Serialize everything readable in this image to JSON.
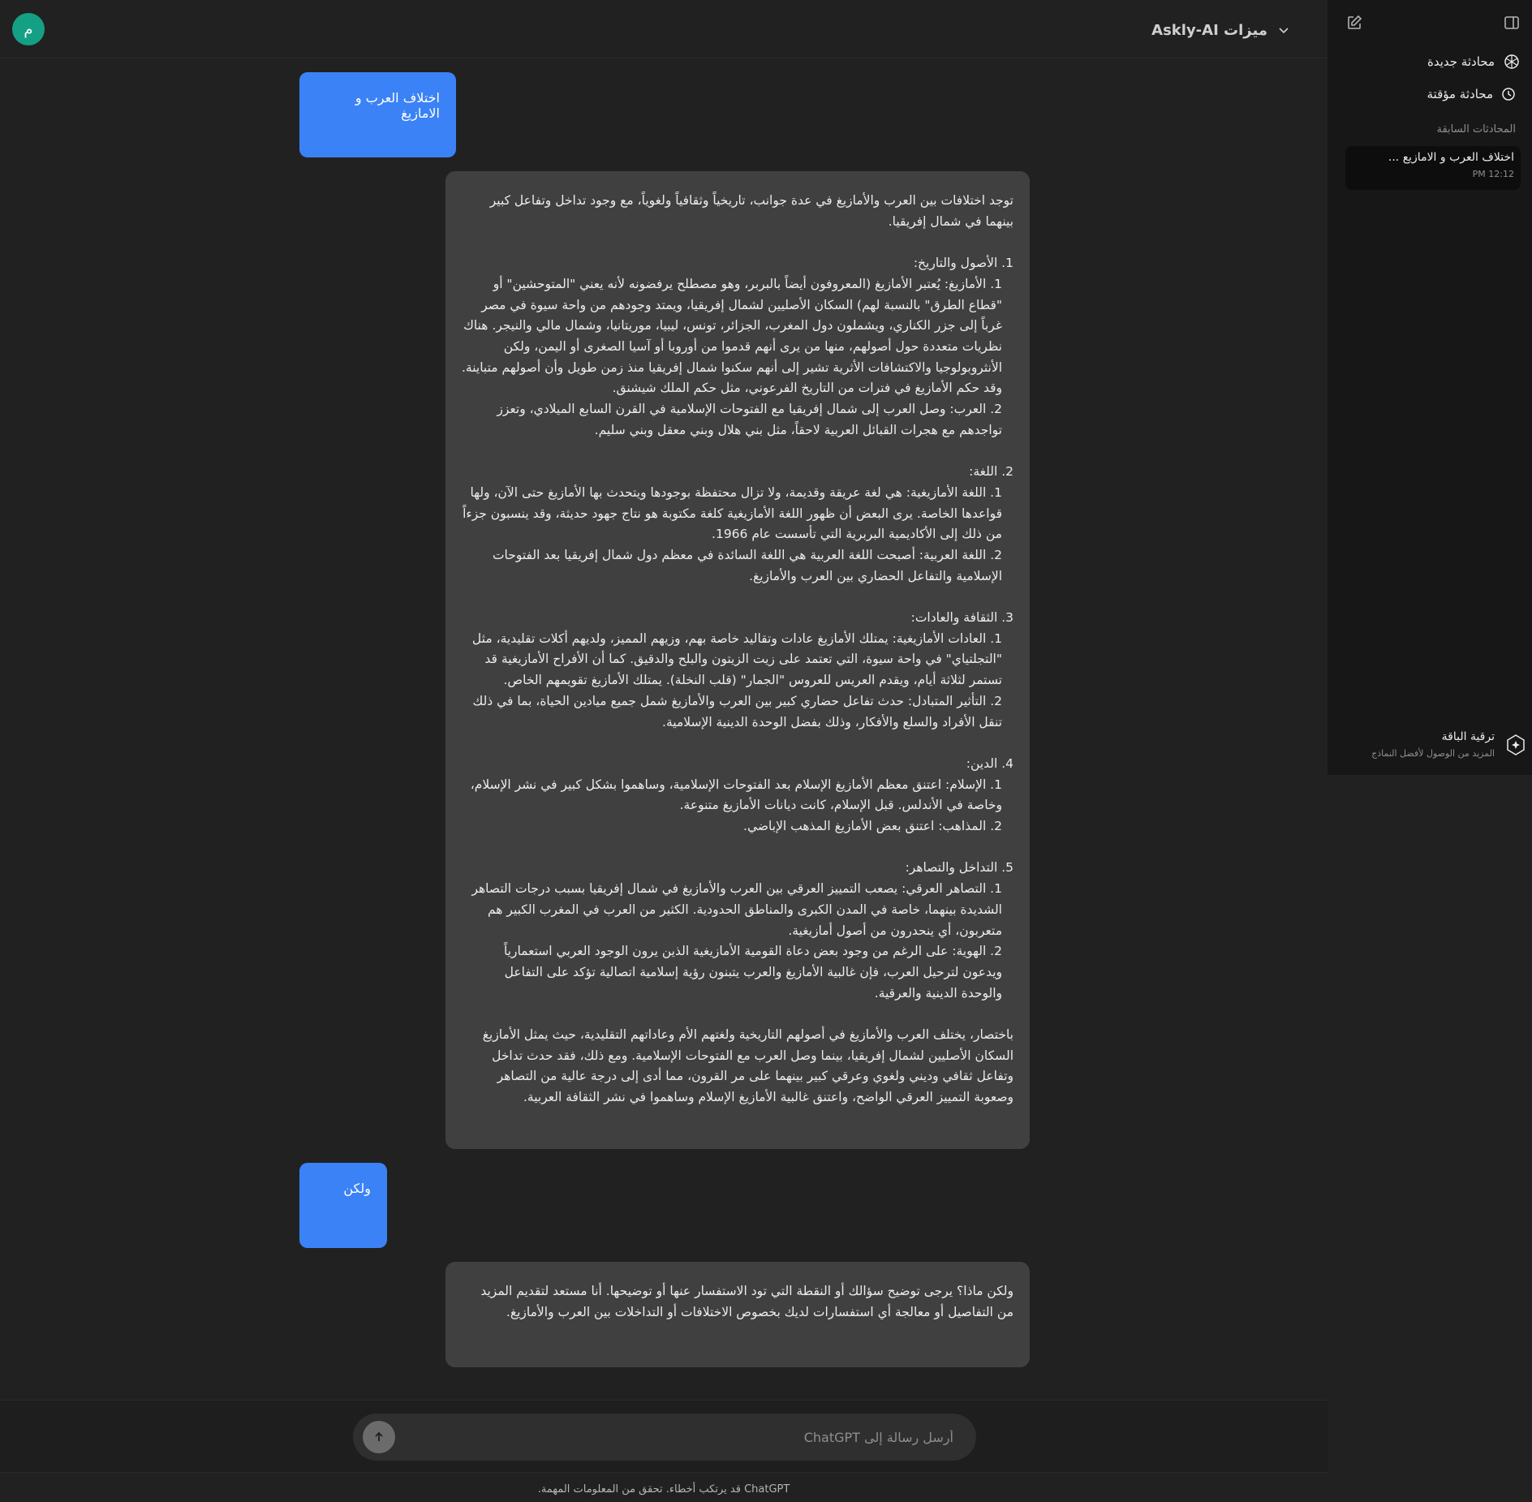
{
  "header": {
    "avatar_letter": "م",
    "model_label": "Askly-AI ميزات"
  },
  "conversation": {
    "user_1": "اختلاف العرب و الامازيغ",
    "assistant_1": {
      "intro": "توجد اختلافات بين العرب والأمازيغ في عدة جوانب، تاريخياً وثقافياً ولغوياً، مع وجود تداخل وتفاعل كبير بينهما في شمال إفريقيا.",
      "s1_title": "1.  الأصول والتاريخ:",
      "s1_p1": "1.  الأمازيغ: يُعتبر الأمازيغ (المعروفون أيضاً بالبربر، وهو مصطلح يرفضونه لأنه يعني \"المتوحشين\" أو \"قطاع الطرق\" بالنسبة لهم) السكان الأصليين لشمال إفريقيا، ويمتد وجودهم من واحة سيوة في مصر غرباً إلى جزر الكناري، ويشملون دول المغرب، الجزائر، تونس، ليبيا، موريتانيا، وشمال مالي والنيجر. هناك نظريات متعددة حول أصولهم، منها من يرى أنهم قدموا من أوروبا أو آسيا الصغرى أو اليمن، ولكن الأنثروبولوجيا والاكتشافات الأثرية تشير إلى أنهم سكنوا شمال إفريقيا منذ زمن طويل وأن أصولهم متباينة. وقد حكم الأمازيغ في فترات من التاريخ الفرعوني، مثل حكم الملك شيشنق.",
      "s1_p2": "2.  العرب: وصل العرب إلى شمال إفريقيا مع الفتوحات الإسلامية في القرن السابع الميلادي، وتعزز تواجدهم مع هجرات القبائل العربية لاحقاً، مثل بني هلال وبني معقل وبني سليم.",
      "s2_title": "2.  اللغة:",
      "s2_p1": "1.  اللغة الأمازيغية: هي لغة عريقة وقديمة، ولا تزال محتفظة بوجودها ويتحدث بها الأمازيغ حتى الآن، ولها قواعدها الخاصة. يرى البعض أن ظهور اللغة الأمازيغية كلغة مكتوبة هو نتاج جهود حديثة، وقد ينسبون جزءاً من ذلك إلى الأكاديمية البربرية التي تأسست عام 1966.",
      "s2_p2": "2.  اللغة العربية: أصبحت اللغة العربية هي اللغة السائدة في معظم دول شمال إفريقيا بعد الفتوحات الإسلامية والتفاعل الحضاري بين العرب والأمازيغ.",
      "s3_title": "3.  الثقافة والعادات:",
      "s3_p1": "1.  العادات الأمازيغية: يمتلك الأمازيغ عادات وتقاليد خاصة بهم، وزيهم المميز، ولديهم أكلات تقليدية، مثل \"التجلتياي\" في واحة سيوة، التي تعتمد على زيت الزيتون والبلح والدقيق. كما أن الأفراح الأمازيغية قد تستمر لثلاثة أيام، ويقدم العريس للعروس \"الجمار\" (قلب النخلة). يمتلك الأمازيغ تقويمهم الخاص.",
      "s3_p2": "2.  التأثير المتبادل: حدث تفاعل حضاري كبير بين العرب والأمازيغ شمل جميع ميادين الحياة، بما في ذلك تنقل الأفراد والسلع والأفكار، وذلك بفضل الوحدة الدينية الإسلامية.",
      "s4_title": "4.  الدين:",
      "s4_p1": "1.  الإسلام: اعتنق معظم الأمازيغ الإسلام بعد الفتوحات الإسلامية، وساهموا بشكل كبير في نشر الإسلام، وخاصة في الأندلس. قبل الإسلام، كانت ديانات الأمازيغ متنوعة.",
      "s4_p2": "2.  المذاهب: اعتنق بعض الأمازيغ المذهب الإباضي.",
      "s5_title": "5.  التداخل والتصاهر:",
      "s5_p1": "1.  التصاهر العرقي: يصعب التمييز العرقي بين العرب والأمازيغ في شمال إفريقيا بسبب درجات التصاهر الشديدة بينهما، خاصة في المدن الكبرى والمناطق الحدودية. الكثير من العرب في المغرب الكبير هم متعربون، أي ينحدرون من أصول أمازيغية.",
      "s5_p2": "2.  الهوية: على الرغم من وجود بعض دعاة القومية الأمازيغية الذين يرون الوجود العربي استعمارياً ويدعون لترحيل العرب، فإن غالبية الأمازيغ والعرب يتبنون رؤية إسلامية اتصالية تؤكد على التفاعل والوحدة الدينية والعرقية.",
      "summary": "باختصار، يختلف العرب والأمازيغ في أصولهم التاريخية ولغتهم الأم وعاداتهم التقليدية، حيث يمثل الأمازيغ السكان الأصليين لشمال إفريقيا، بينما وصل العرب مع الفتوحات الإسلامية. ومع ذلك، فقد حدث تداخل وتفاعل ثقافي وديني ولغوي وعرقي كبير بينهما على مر القرون، مما أدى إلى درجة عالية من التصاهر وصعوبة التمييز العرقي الواضح، واعتنق غالبية الأمازيغ الإسلام وساهموا في نشر الثقافة العربية."
    },
    "user_2": "ولكن",
    "assistant_2": "ولكن ماذا؟ يرجى توضيح سؤالك أو النقطة التي تود الاستفسار عنها أو توضيحها. أنا مستعد لتقديم المزيد من التفاصيل أو معالجة أي استفسارات لديك بخصوص الاختلافات أو التداخلات بين العرب والأمازيغ."
  },
  "composer": {
    "placeholder": "أرسل رسالة إلى ChatGPT"
  },
  "disclaimer": "ChatGPT قد يرتكب أخطاء. تحقق من المعلومات المهمة.",
  "sidebar": {
    "new_chat": "محادثة جديدة",
    "temp_chat": "محادثة مؤقتة",
    "previous_label": "المحادثات السابقة",
    "history": [
      {
        "title": "اختلاف العرب و الامازيع ...",
        "time": "PM 12:12"
      }
    ],
    "upgrade_title": "ترقية الباقة",
    "upgrade_subtitle": "المزيد من الوصول لأفضل النماذج"
  },
  "colors": {
    "user_bubble": "#3b82f6",
    "assistant_bubble": "#404040",
    "avatar": "#14a085",
    "background": "#212121",
    "sidebar": "#171717"
  }
}
